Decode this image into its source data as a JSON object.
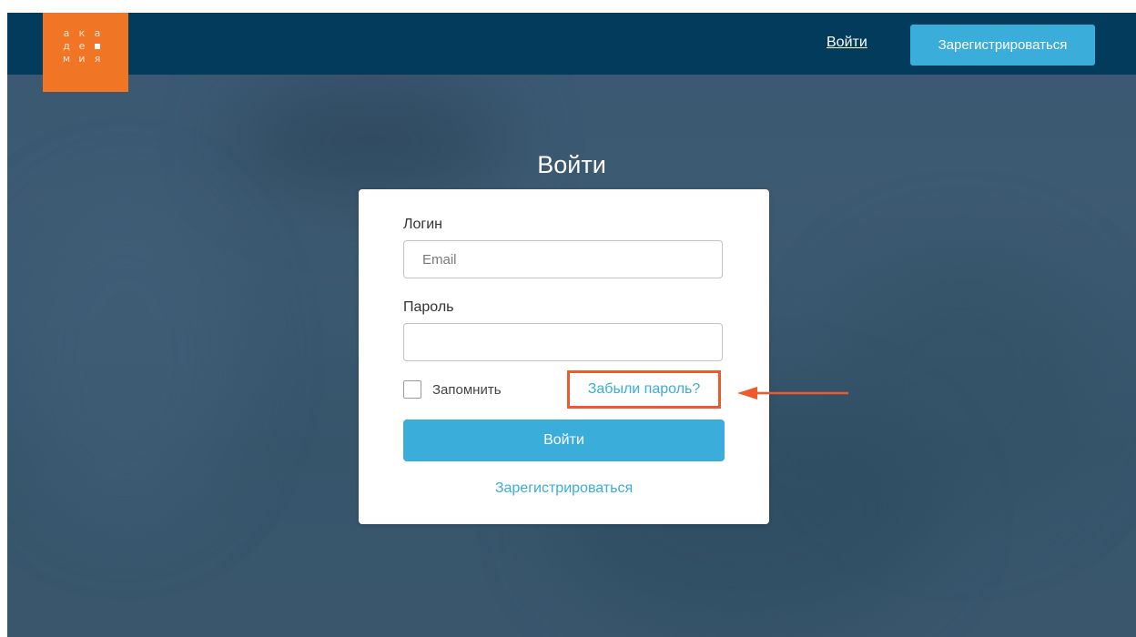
{
  "header": {
    "logo_letters": [
      "а",
      "к",
      "а",
      "д",
      "е",
      "",
      "м",
      "и",
      "я"
    ],
    "login_link": "Войти",
    "register_button": "Зарегистрироваться"
  },
  "page": {
    "title": "Войти"
  },
  "form": {
    "login_label": "Логин",
    "login_placeholder": "Email",
    "login_value": "",
    "password_label": "Пароль",
    "password_value": "",
    "remember_label": "Запомнить",
    "remember_checked": false,
    "forgot_link": "Забыли пароль?",
    "submit_button": "Войти",
    "register_link": "Зарегистрироваться"
  },
  "annotation": {
    "highlight_color": "#ee5a2e",
    "arrow_icon": "arrow-left-icon"
  },
  "colors": {
    "header_bg": "#023b5b",
    "logo_bg": "#f07625",
    "accent": "#3aaddb"
  }
}
